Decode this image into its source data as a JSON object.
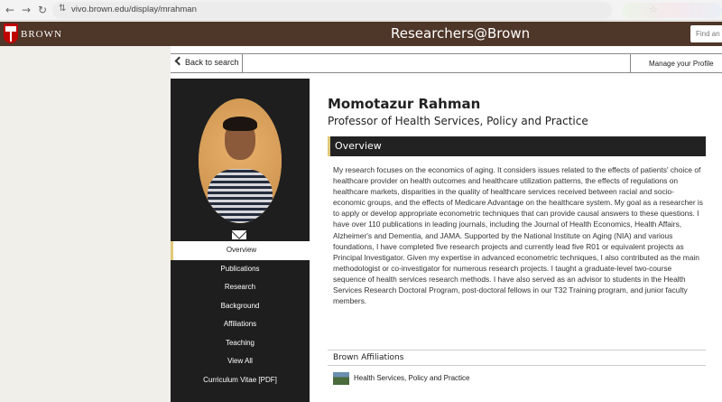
{
  "browser": {
    "url": "vivo.brown.edu/display/mrahman",
    "back_glyph": "←",
    "forward_glyph": "→",
    "reload_glyph": "↻",
    "site_info_glyph": "⇅",
    "star_glyph": "☆"
  },
  "header": {
    "brand": "BROWN",
    "site_title": "Researchers@Brown",
    "search_placeholder": "Find an e"
  },
  "topbar": {
    "back_label": "Back to search",
    "manage_label": "Manage your Profile"
  },
  "profile": {
    "name": "Momotazur Rahman",
    "title": "Professor of Health Services, Policy and Practice"
  },
  "sidebar": {
    "items": [
      {
        "label": "Overview"
      },
      {
        "label": "Publications"
      },
      {
        "label": "Research"
      },
      {
        "label": "Background"
      },
      {
        "label": "Affiliations"
      },
      {
        "label": "Teaching"
      },
      {
        "label": "View All"
      },
      {
        "label": "Curriculum Vitae [PDF]"
      }
    ]
  },
  "overview": {
    "heading": "Overview",
    "bio": "My research focuses on the economics of aging. It considers issues related to the effects of patients' choice of healthcare provider on health outcomes and healthcare utilization patterns, the effects of regulations on healthcare markets, disparities in the quality of healthcare services received between racial and socio-economic groups, and the effects of Medicare Advantage on the healthcare system. My goal as a researcher is to apply or develop appropriate econometric techniques that can provide causal answers to these questions. I have over 110 publications in leading journals, including the Journal of Health Economics, Health Affairs, Alzheimer's and Dementia, and JAMA. Supported by the National Institute on Aging (NIA) and various foundations, I have completed five research projects and currently lead five R01 or equivalent projects as Principal Investigator. Given my expertise in advanced econometric techniques, I also contributed as the main methodologist or co-investigator for numerous research projects. I taught a graduate-level two-course sequence of health services research methods. I have also served as an advisor to students in the Health Services Research Doctoral Program, post-doctoral fellows in our T32 Training program, and junior faculty members."
  },
  "affiliations": {
    "heading": "Brown Affiliations",
    "items": [
      {
        "label": "Health Services, Policy and Practice"
      }
    ]
  }
}
